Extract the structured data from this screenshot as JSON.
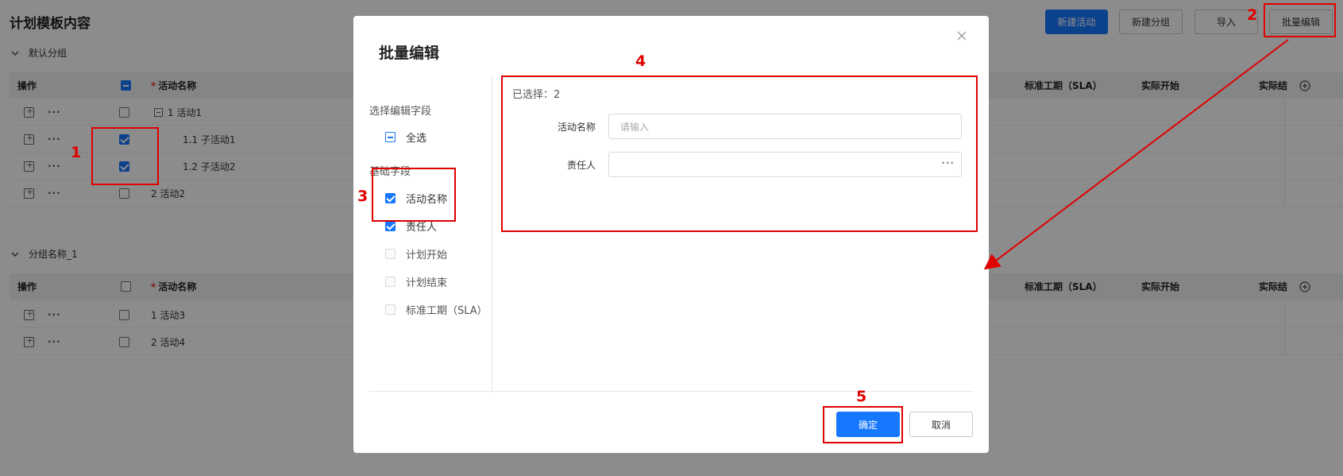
{
  "page": {
    "title": "计划模板内容",
    "toolbar": {
      "new_activity": "新建活动",
      "new_group": "新建分组",
      "import": "导入",
      "batch_edit": "批量编辑"
    }
  },
  "groups": [
    {
      "name": "默认分组",
      "header": {
        "ops": "操作",
        "name_col": "活动名称",
        "sla_col": "标准工期（SLA）",
        "actual_start_col": "实际开始",
        "actual_col_partial": "实际结"
      },
      "rows": [
        {
          "label": "1 活动1",
          "checked": false,
          "indent": 0,
          "collapsible": true
        },
        {
          "label": "1.1 子活动1",
          "checked": true,
          "indent": 1
        },
        {
          "label": "1.2 子活动2",
          "checked": true,
          "indent": 1
        },
        {
          "label": "2 活动2",
          "checked": false,
          "indent": 0
        }
      ]
    },
    {
      "name": "分组名称_1",
      "header": {
        "ops": "操作",
        "name_col": "活动名称",
        "sla_col": "标准工期（SLA）",
        "actual_start_col": "实际开始",
        "actual_col_partial": "实际结"
      },
      "rows": [
        {
          "label": "1 活动3",
          "checked": false,
          "indent": 0
        },
        {
          "label": "2 活动4",
          "checked": false,
          "indent": 0
        }
      ]
    }
  ],
  "dialog": {
    "title": "批量编辑",
    "close_icon": "close-icon",
    "left": {
      "section_select_label": "选择编辑字段",
      "select_all_label": "全选",
      "section_basic_label": "基础字段",
      "fields": [
        {
          "label": "活动名称",
          "checked": true
        },
        {
          "label": "责任人",
          "checked": true
        },
        {
          "label": "计划开始",
          "checked": false
        },
        {
          "label": "计划结束",
          "checked": false
        },
        {
          "label": "标准工期（SLA）",
          "checked": false
        }
      ]
    },
    "right": {
      "selected_text": "已选择：2",
      "form": [
        {
          "label": "活动名称",
          "placeholder": "请输入"
        },
        {
          "label": "责任人",
          "placeholder": ""
        }
      ]
    },
    "footer": {
      "ok": "确定",
      "cancel": "取消"
    }
  },
  "annotations": [
    "1",
    "2",
    "3",
    "4",
    "5"
  ],
  "colors": {
    "primary": "#1677ff",
    "annotation": "#e00000",
    "mask": "rgba(0,0,0,0.45)"
  }
}
